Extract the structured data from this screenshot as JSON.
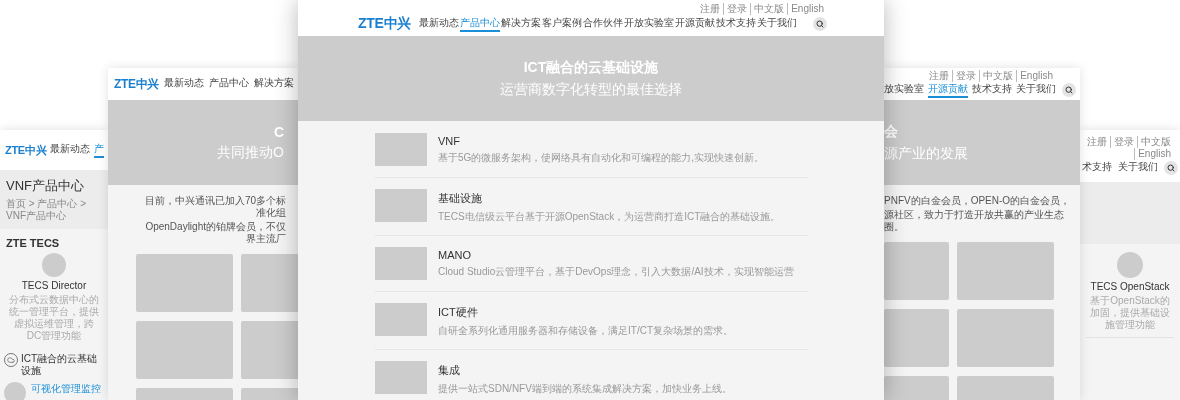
{
  "back_left_page": {
    "logo": "ZTE中兴",
    "nav": [
      {
        "label": "最新动态",
        "selected": false
      },
      {
        "label": "产",
        "selected": true
      }
    ],
    "title": "VNF产品中心",
    "breadcrumb": "首页 > 产品中心 > VNF产品中心",
    "section": "ZTE TECS",
    "product": {
      "name": "TECS Director",
      "description": "分布式云数据中心的统一管理平台，提供虚拟运维管理，跨DC管理功能"
    },
    "category": "ICT融合的云基础设施",
    "feature": "可视化管理监控"
  },
  "left_page": {
    "logo": "ZTE中兴",
    "nav": [
      "最新动态",
      "产品中心",
      "解决方案"
    ],
    "banner": {
      "title": "C",
      "subtitle": "共同推动O"
    },
    "intro": [
      "目前，中兴通讯已加入70多个标准化组",
      "OpenDaylight的铂牌会员，不仅界主流厂"
    ]
  },
  "main_page": {
    "logo": "ZTE中兴",
    "top_links": [
      "注册",
      "登录",
      "中文版",
      "English"
    ],
    "nav": [
      {
        "label": "最新动态",
        "selected": false
      },
      {
        "label": "产品中心",
        "selected": true
      },
      {
        "label": "解决方案",
        "selected": false
      },
      {
        "label": "客户案例",
        "selected": false
      },
      {
        "label": "合作伙伴",
        "selected": false
      },
      {
        "label": "开放实验室",
        "selected": false
      },
      {
        "label": "开源贡献",
        "selected": false
      },
      {
        "label": "技术支持",
        "selected": false
      },
      {
        "label": "关于我们",
        "selected": false
      }
    ],
    "banner": {
      "title": "ICT融合的云基础设施",
      "subtitle": "运营商数字化转型的最佳选择"
    },
    "products": [
      {
        "title": "VNF",
        "description": "基于5G的微服务架构，使网络具有自动化和可编程的能力,实现快速创新。"
      },
      {
        "title": "基础设施",
        "description": "TECS电信级云平台基于开源OpenStack，为运营商打造ICT融合的基础设施。"
      },
      {
        "title": "MANO",
        "description": "Cloud Studio云管理平台，基于DevOps理念，引入大数据/AI技术，实现智能运营"
      },
      {
        "title": "ICT硬件",
        "description": "自研全系列化通用服务器和存储设备，满足IT/CT复杂场景的需求。"
      },
      {
        "title": "集成",
        "description": "提供一站式SDN/NFV端到端的系统集成解决方案，加快业务上线。"
      }
    ]
  },
  "right_page": {
    "top_links": [
      "注册",
      "登录",
      "中文版",
      "English"
    ],
    "nav": [
      {
        "label": "放实验室",
        "selected": false
      },
      {
        "label": "开源贡献",
        "selected": true
      },
      {
        "label": "技术支持",
        "selected": false
      },
      {
        "label": "关于我们",
        "selected": false
      }
    ],
    "banner": {
      "title": "会",
      "subtitle": "源产业的发展"
    },
    "intro": [
      "PNFV的白金会员，OPEN-O的白金会员，",
      "源社区，致力于打造开放共赢的产业生态圈。"
    ]
  },
  "back_right_page": {
    "top_links": [
      "注册",
      "登录",
      "中文版",
      "English"
    ],
    "nav": [
      "术支持",
      "关于我们"
    ],
    "product": {
      "name": "TECS OpenStack",
      "description": "基于OpenStack的加固，提供基础设施管理功能"
    }
  }
}
